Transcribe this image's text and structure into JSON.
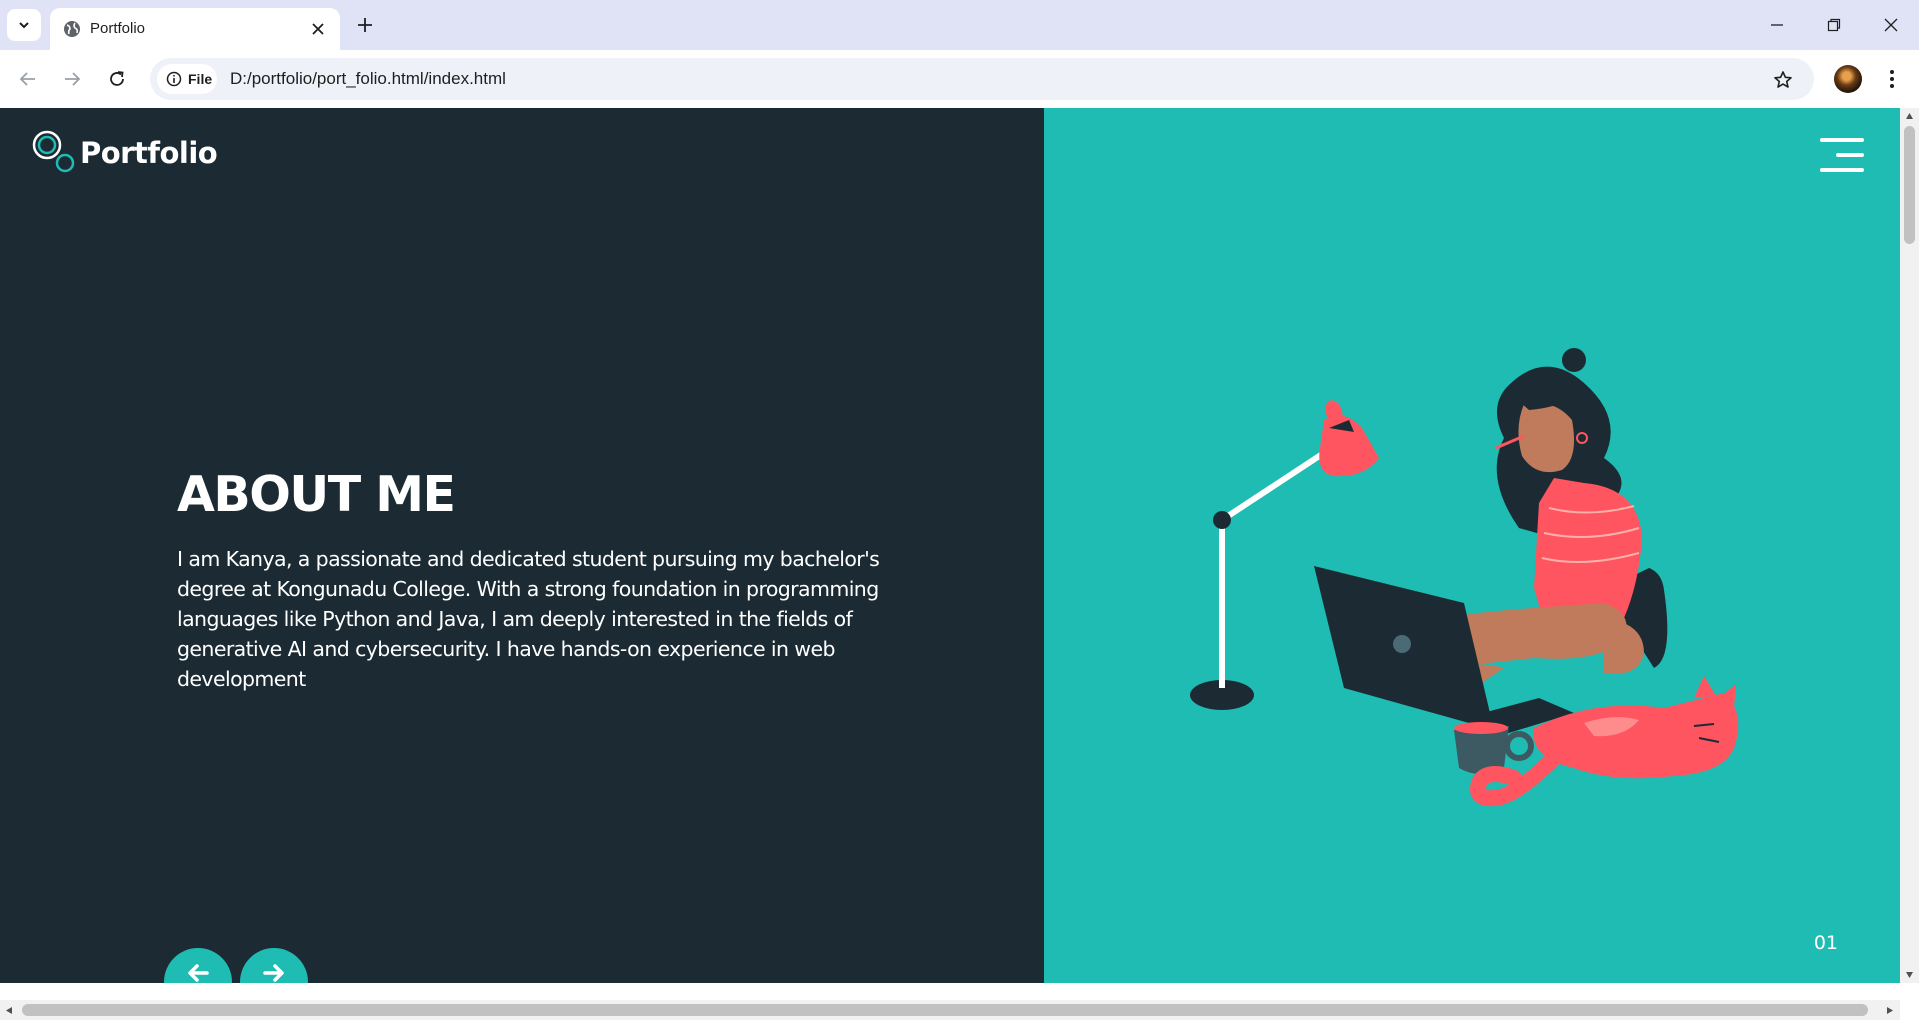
{
  "browser": {
    "tab": {
      "title": "Portfolio",
      "favicon": "globe-icon"
    },
    "address_bar": {
      "chip_label": "File",
      "url": "D:/portfolio/port_folio.html/index.html"
    }
  },
  "page": {
    "logo_text": "Portfolio",
    "about": {
      "heading": "ABOUT ME",
      "paragraph": "I am Kanya, a passionate and dedicated student pursuing my bachelor's degree at Kongunadu College. With a strong foundation in programming languages like Python and Java, I am deeply interested in the fields of generative AI and cybersecurity. I have hands-on experience in web development"
    },
    "slide_number": "01",
    "colors": {
      "left_panel": "#1c2b33",
      "right_panel": "#1fbcb3",
      "accent_coral": "#ff5560"
    },
    "icons": {
      "logo": "circles-logo-icon",
      "menu": "hamburger-menu-icon",
      "prev": "arrow-left-icon",
      "next": "arrow-right-icon",
      "illustration": "woman-laptop-cat-illustration"
    }
  }
}
